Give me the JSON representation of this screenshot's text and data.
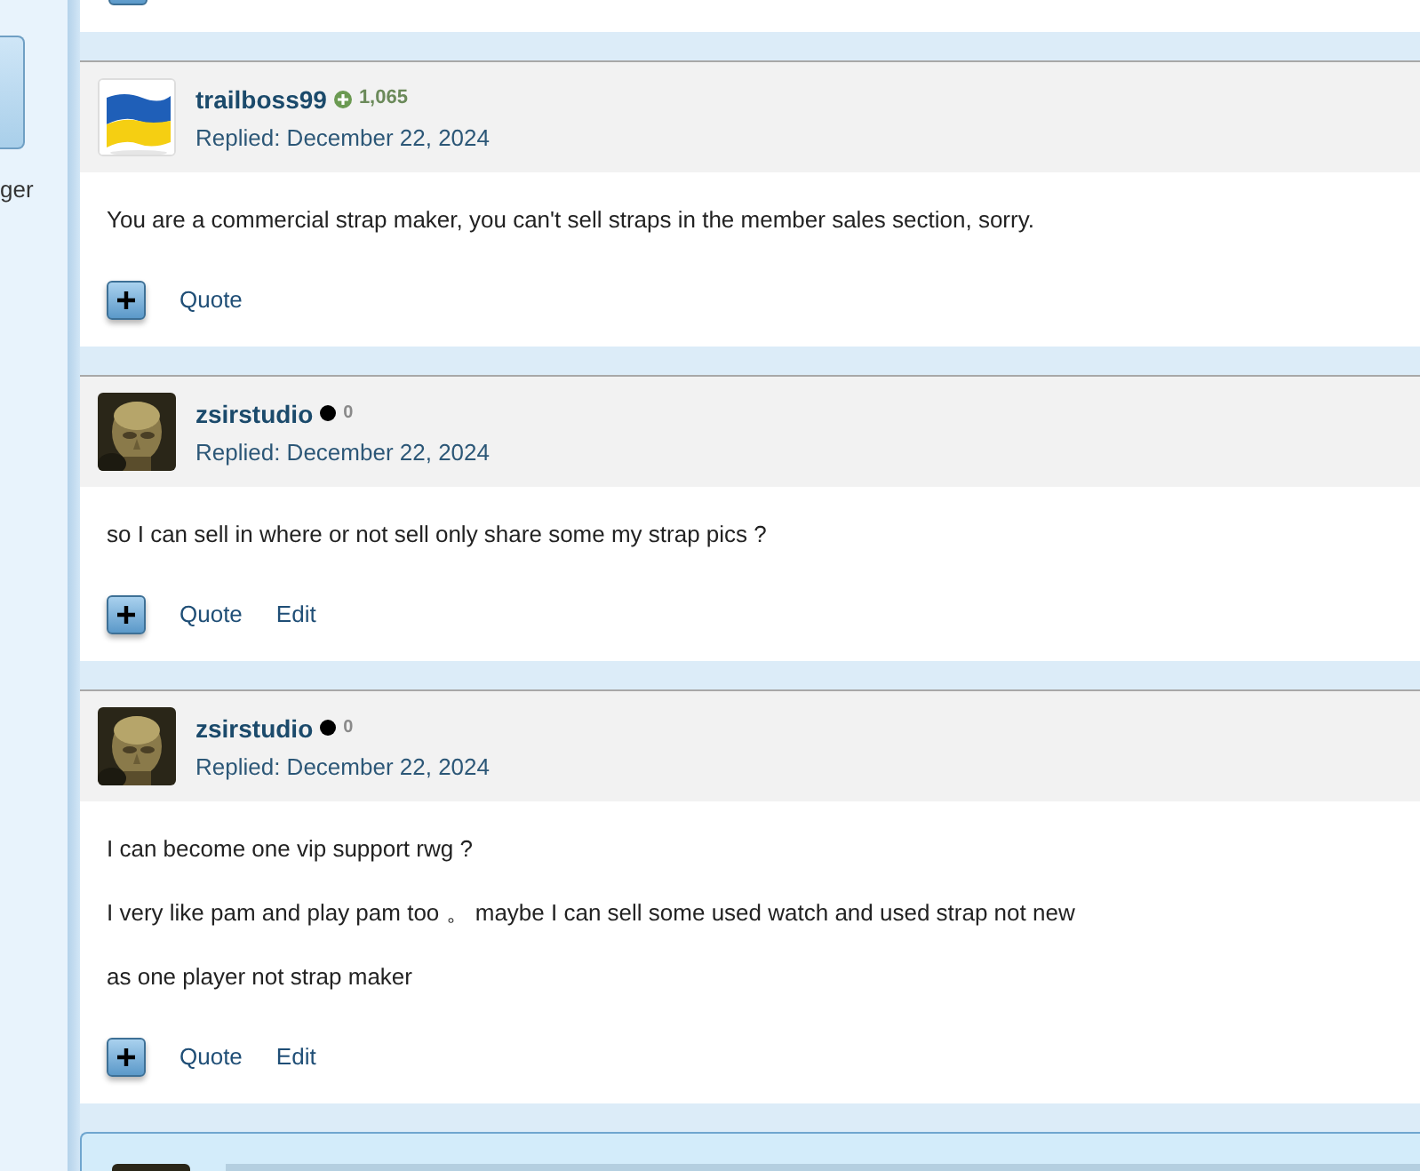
{
  "sidebar": {
    "text_fragment": "ger"
  },
  "posts": [
    {
      "author": "trailboss99",
      "reputation": {
        "kind": "positive",
        "value": "1,065"
      },
      "replied": "Replied: December 22, 2024",
      "paragraphs": [
        "You are a commercial strap maker, you can't sell straps in the member sales section, sorry."
      ],
      "actions": [
        "Quote"
      ]
    },
    {
      "author": "zsirstudio",
      "reputation": {
        "kind": "neutral",
        "value": "0"
      },
      "replied": "Replied: December 22, 2024",
      "paragraphs": [
        "so I can sell in where or not sell only share some my strap pics ?"
      ],
      "actions": [
        "Quote",
        "Edit"
      ]
    },
    {
      "author": "zsirstudio",
      "reputation": {
        "kind": "neutral",
        "value": "0"
      },
      "replied": "Replied: December 22, 2024",
      "paragraphs": [
        "I can become one vip support rwg ?",
        "I very like pam and play pam too 。 maybe I can sell some used watch and used strap not new",
        "as one player not strap maker"
      ],
      "actions": [
        "Quote",
        "Edit"
      ]
    }
  ]
}
